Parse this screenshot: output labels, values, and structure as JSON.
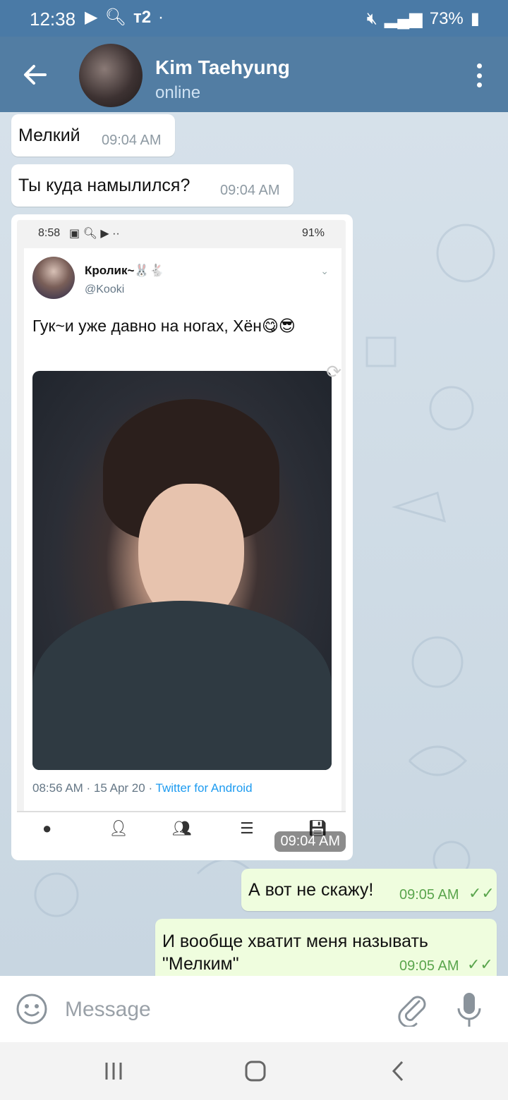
{
  "status_bar": {
    "time": "12:38",
    "battery": "73%"
  },
  "header": {
    "title": "Kim Taehyung",
    "status": "online"
  },
  "messages": [
    {
      "text": "Мелкий",
      "time": "09:04 AM",
      "direction": "incoming"
    },
    {
      "text": "Ты куда намылился?",
      "time": "09:04 AM",
      "direction": "incoming"
    },
    {
      "type": "image",
      "time": "09:04 AM",
      "direction": "incoming",
      "screenshot": {
        "status_time": "8:58",
        "battery": "91%",
        "tweet": {
          "name": "Кролик~🐰🐇",
          "handle": "@Kooki",
          "text": "Гук~и уже давно на ногах, Хён😋😎",
          "timestamp": "08:56 AM · 15 Apr 20 · ",
          "source": "Twitter for Android"
        }
      }
    },
    {
      "text": "А вот не скажу!",
      "time": "09:05 AM",
      "direction": "outgoing",
      "read": true
    },
    {
      "text": "И вообще хватит меня называть \"Мелким\"",
      "time": "09:05 AM",
      "direction": "outgoing",
      "read": true
    }
  ],
  "composer": {
    "placeholder": "Message"
  },
  "colors": {
    "header": "#527da3",
    "status_bar": "#4a7aa6",
    "outgoing_bubble": "#effdde",
    "read_check": "#5aa54d"
  }
}
